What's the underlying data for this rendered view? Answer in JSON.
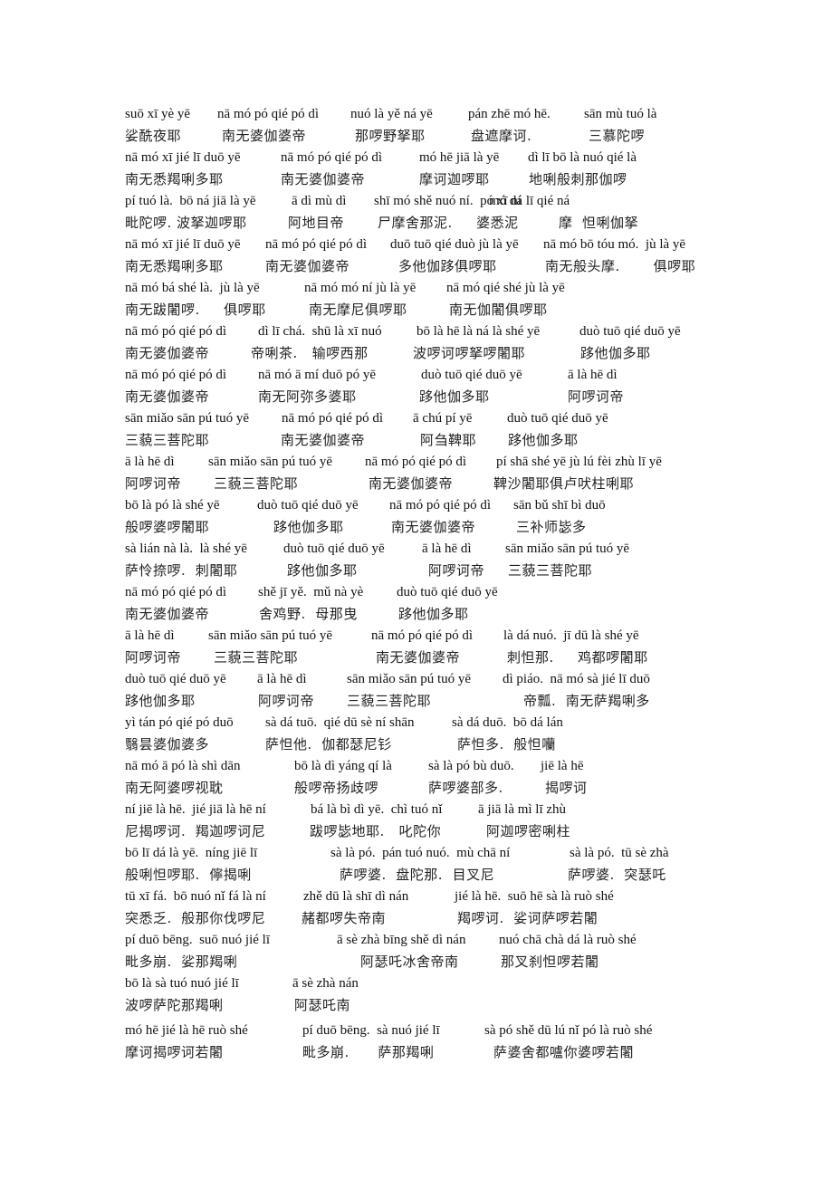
{
  "document": {
    "title": "",
    "blocks": [
      {
        "pinyin": [
          "suō xī yè yē",
          "nā mó pó qié pó dì",
          "nuó là yě ná yē",
          "pán zhē mó hē.",
          "sān mù tuó là"
        ],
        "hanzi": [
          "娑酰夜耶",
          "南无婆伽婆帝",
          "那啰野拏耶",
          "盘遮摩诃.",
          "三慕陀啰"
        ]
      },
      {
        "pinyin": [
          "nā mó xī jié lī duō yē",
          "nā mó pó qié pó dì",
          "mó hē jiā là yē",
          "dì lī bō là nuó qié là"
        ],
        "hanzi": [
          "南无悉羯唎多耶",
          "南无婆伽婆帝",
          "摩诃迦啰耶",
          "地唎般刺那伽啰"
        ]
      },
      {
        "pinyin": [
          "pí tuó là.  bō ná jiā là yē",
          "ā dì mù dì",
          "shī mó shě nuó ní.  pó xī ní",
          "mó dá lī qié ná"
        ],
        "hanzi": [
          "毗陀啰. 波拏迦啰耶",
          "阿地目帝",
          "尸摩舍那泥.     婆悉泥",
          "摩  怛唎伽拏"
        ]
      },
      {
        "pinyin": [
          "nā mó xī jié lī duō yē",
          "nā mó pó qié pó dì",
          "duō tuō qié duò jù là yē",
          "nā mó bō tóu mó.  jù là yē"
        ],
        "hanzi": [
          "南无悉羯唎多耶",
          "南无婆伽婆帝",
          "多他伽跢俱啰耶",
          "南无般头摩.       俱啰耶"
        ]
      },
      {
        "pinyin": [
          "nā mó bá shé là.  jù là yē",
          "nā mó mó ní jù là yē",
          "nā mó qié shé jù là yē"
        ],
        "hanzi": [
          "南无跋闍啰.     俱啰耶",
          "南无摩尼俱啰耶",
          "南无伽闍俱啰耶"
        ]
      },
      {
        "pinyin": [
          "nā mó pó qié pó dì",
          "dì lī chá.  shū là xī nuó",
          "bō là hē là ná là shé yē",
          "duò tuō qié duō yē"
        ],
        "hanzi": [
          "南无婆伽婆帝",
          "帝唎茶.   输啰西那",
          "波啰诃啰拏啰闍耶",
          "跢他伽多耶"
        ]
      },
      {
        "pinyin": [
          "nā mó pó qié pó dì",
          "nā mó ā mí duō pó yē",
          "duò tuō qié duō yē",
          "ā là hē dì"
        ],
        "hanzi": [
          "南无婆伽婆帝",
          "南无阿弥多婆耶",
          "跢他伽多耶",
          "阿啰诃帝"
        ]
      },
      {
        "pinyin": [
          "sān miǎo sān pú tuó yē",
          "nā mó pó qié pó dì",
          "ā chú pí yē",
          "duò tuō qié duō yē"
        ],
        "hanzi": [
          "三藐三菩陀耶",
          "南无婆伽婆帝",
          "阿刍鞞耶",
          "跢他伽多耶"
        ]
      },
      {
        "pinyin": [
          "ā là hē dì",
          "sān miǎo sān pú tuó yē",
          "nā mó pó qié pó dì",
          "pí shā shé yē jù lú fèi zhù lī yē"
        ],
        "hanzi": [
          "阿啰诃帝",
          "三藐三菩陀耶",
          "南无婆伽婆帝",
          "鞞沙闍耶俱卢吠柱唎耶"
        ]
      },
      {
        "pinyin": [
          "bō là pó là shé yē",
          "duò tuō qié duō yē",
          "nā mó pó qié pó dì",
          "sān bǔ shī bì duō"
        ],
        "hanzi": [
          "般啰婆啰闍耶",
          "跢他伽多耶",
          "南无婆伽婆帝",
          "三补师毖多"
        ]
      },
      {
        "pinyin": [
          "sà lián nà là.  là shé yē",
          "duò tuō qié duō yē",
          "ā là hē dì",
          "sān miǎo sān pú tuó yē"
        ],
        "hanzi": [
          "萨怜捺啰.  刺闍耶",
          "跢他伽多耶",
          "阿啰诃帝",
          "三藐三菩陀耶"
        ]
      },
      {
        "pinyin": [
          "nā mó pó qié pó dì",
          "shě jī yě.  mǔ nà yè",
          "duò tuō qié duō yē"
        ],
        "hanzi": [
          "南无婆伽婆帝",
          "舍鸡野.  母那曳",
          "跢他伽多耶"
        ]
      },
      {
        "pinyin": [
          "ā là hē dì",
          "sān miǎo sān pú tuó yē",
          "nā mó pó qié pó dì",
          "là dá nuó.  jī dū là shé yē"
        ],
        "hanzi": [
          "阿啰诃帝",
          "三藐三菩陀耶",
          "南无婆伽婆帝",
          "刺怛那.     鸡都啰闍耶"
        ]
      },
      {
        "pinyin": [
          "duò tuō qié duō yē",
          "ā là hē dì",
          "sān miǎo sān pú tuó yē",
          "dì piáo.  nā mó sà jié lī duō"
        ],
        "hanzi": [
          "跢他伽多耶",
          "阿啰诃帝",
          "三藐三菩陀耶",
          "帝瓢.  南无萨羯唎多"
        ]
      },
      {
        "pinyin": [
          "yì tán pó qié pó duō",
          "sà dá tuō.  qié dū sè ní shān",
          "sà dá duō.  bō dá lán"
        ],
        "hanzi": [
          "翳昙婆伽婆多",
          "萨怛他.  伽都瑟尼钐",
          "萨怛多.  般怛囒"
        ]
      },
      {
        "pinyin": [
          "nā mó ā pó là shì dān",
          "bō là dì yáng qí là",
          "sà là pó bù duō.",
          "jiē là hē"
        ],
        "hanzi": [
          "南无阿婆啰视耽",
          "般啰帝扬歧啰",
          "萨啰婆部多.",
          "揭啰诃"
        ]
      },
      {
        "pinyin": [
          "ní jiē là hē.  jié jiā là hē ní",
          "bá là bì dì yē.  chì tuó nǐ",
          "ā jiā là mì lī zhù"
        ],
        "hanzi": [
          "尼揭啰诃.  羯迦啰诃尼",
          "跋啰毖地耶.   叱陀你",
          "阿迦啰密唎柱"
        ]
      },
      {
        "pinyin": [
          "bō lī dá là yē.  níng jiē lī",
          "sà là pó.  pán tuó nuó.  mù chā ní",
          "sà là pó.  tū sè zhà"
        ],
        "hanzi": [
          "般唎怛啰耶.  儜揭唎",
          "萨啰婆.  盘陀那.  目叉尼",
          "萨啰婆.  突瑟吒"
        ]
      },
      {
        "pinyin": [
          "tū xī fá.  bō nuó nǐ fá là ní",
          "zhě dū là shī dì nán",
          "jié là hē.  suō hē sà là ruò shé"
        ],
        "hanzi": [
          "突悉乏.  般那你伐啰尼",
          "赭都啰失帝南",
          "羯啰诃.  娑诃萨啰若闍"
        ]
      },
      {
        "pinyin": [
          "pí duō bēng.  suō nuó jié lī",
          "ā sè zhà bīng shě dì nán",
          "nuó chā chà dá là ruò shé"
        ],
        "hanzi": [
          "毗多崩.  娑那羯唎",
          "阿瑟吒冰舍帝南",
          "那叉刹怛啰若闍"
        ]
      },
      {
        "pinyin": [
          "bō là sà tuó nuó jié lī",
          "ā sè zhà nán"
        ],
        "hanzi": [
          "波啰萨陀那羯唎",
          "阿瑟吒南"
        ]
      },
      {
        "pinyin": [
          "mó hē jié là hē ruò shé",
          "pí duō bēng.  sà nuó jié lī",
          "sà pó shě dū lú nǐ pó là ruò shé"
        ],
        "hanzi": [
          "摩诃揭啰诃若闍",
          "毗多崩.      萨那羯唎",
          "萨婆舍都嚧你婆啰若闍"
        ]
      }
    ]
  }
}
